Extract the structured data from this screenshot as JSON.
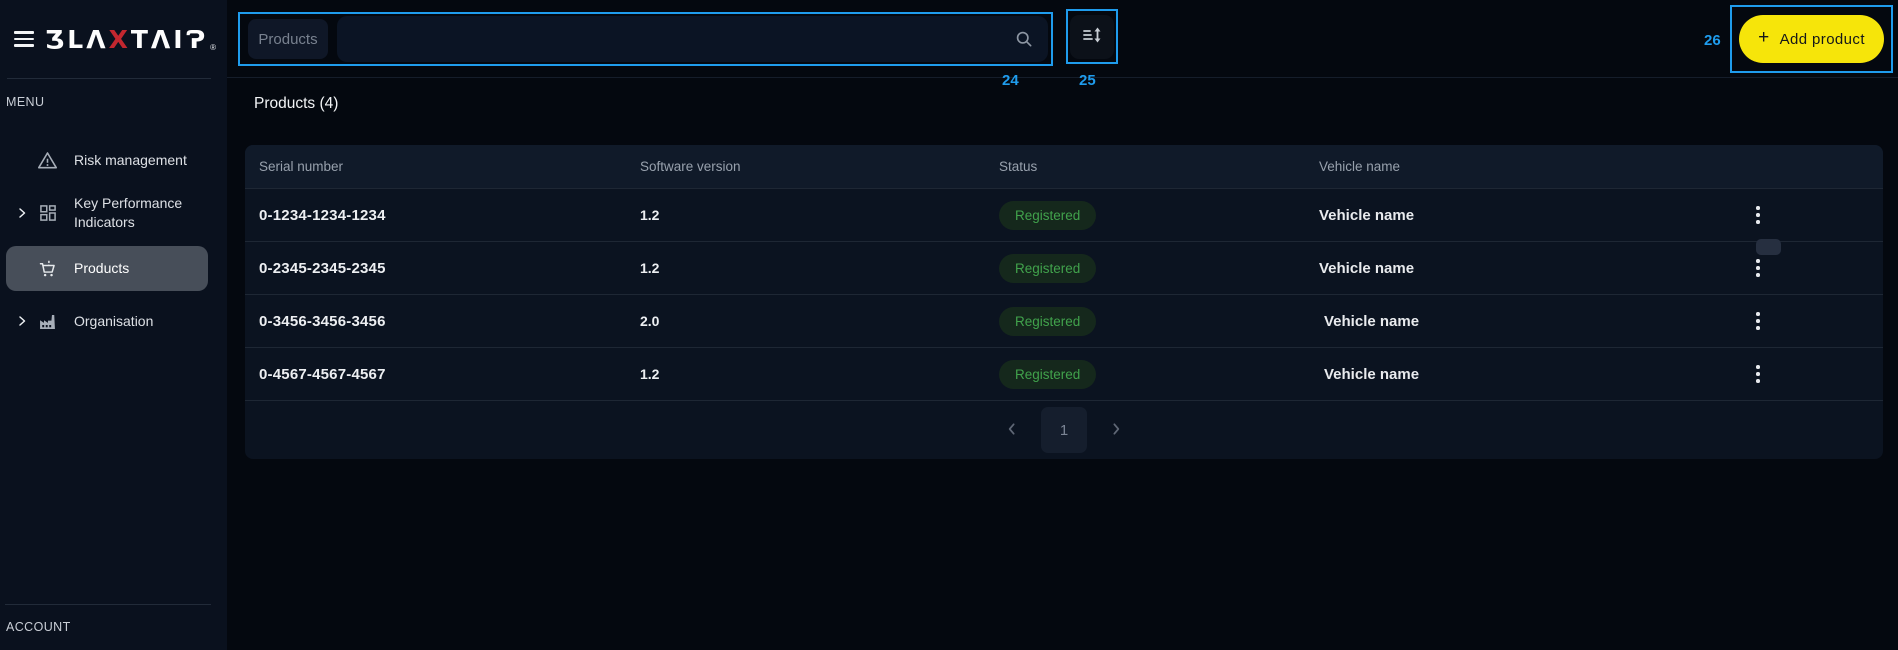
{
  "colors": {
    "annotation_blue": "#1f9ced",
    "accent_yellow": "#f6e50a",
    "logo_accent_red": "#c3272f",
    "status_registered_bg": "#15281c",
    "status_registered_text": "#41a24c",
    "active_item_bg": "#474e59"
  },
  "sidebar": {
    "logo": {
      "part1": "ƷLΛ",
      "accent": "X",
      "part2": "TΛIɁ",
      "registered_mark": "®"
    },
    "menu_label": "MENU",
    "items": [
      {
        "label": "Risk management",
        "icon": "warning-triangle-icon",
        "expandable": false,
        "active": false
      },
      {
        "label": "Key Performance Indicators",
        "icon": "dashboard-grid-icon",
        "expandable": true,
        "active": false
      },
      {
        "label": "Products",
        "icon": "shopping-cart-icon",
        "expandable": false,
        "active": true
      },
      {
        "label": "Organisation",
        "icon": "factory-icon",
        "expandable": true,
        "active": false
      }
    ],
    "account_label": "ACCOUNT"
  },
  "topbar": {
    "filter_chip": "Products",
    "search_value": "",
    "search_placeholder": "",
    "add_button": {
      "plus": "+",
      "label": "Add product"
    }
  },
  "annotations": {
    "search_box_label": "24",
    "sort_button_label": "25",
    "add_button_label": "26"
  },
  "content": {
    "title": "Products (4)",
    "table": {
      "columns": [
        "Serial number",
        "Software version",
        "Status",
        "Vehicle name"
      ],
      "rows": [
        {
          "serial": "0-1234-1234-1234",
          "version": "1.2",
          "status": "Registered",
          "vehicle": "Vehicle name"
        },
        {
          "serial": "0-2345-2345-2345",
          "version": "1.2",
          "status": "Registered",
          "vehicle": "Vehicle name"
        },
        {
          "serial": "0-3456-3456-3456",
          "version": "2.0",
          "status": "Registered",
          "vehicle": "Vehicle name"
        },
        {
          "serial": "0-4567-4567-4567",
          "version": "1.2",
          "status": "Registered",
          "vehicle": "Vehicle name"
        }
      ]
    },
    "pagination": {
      "page": "1"
    }
  }
}
